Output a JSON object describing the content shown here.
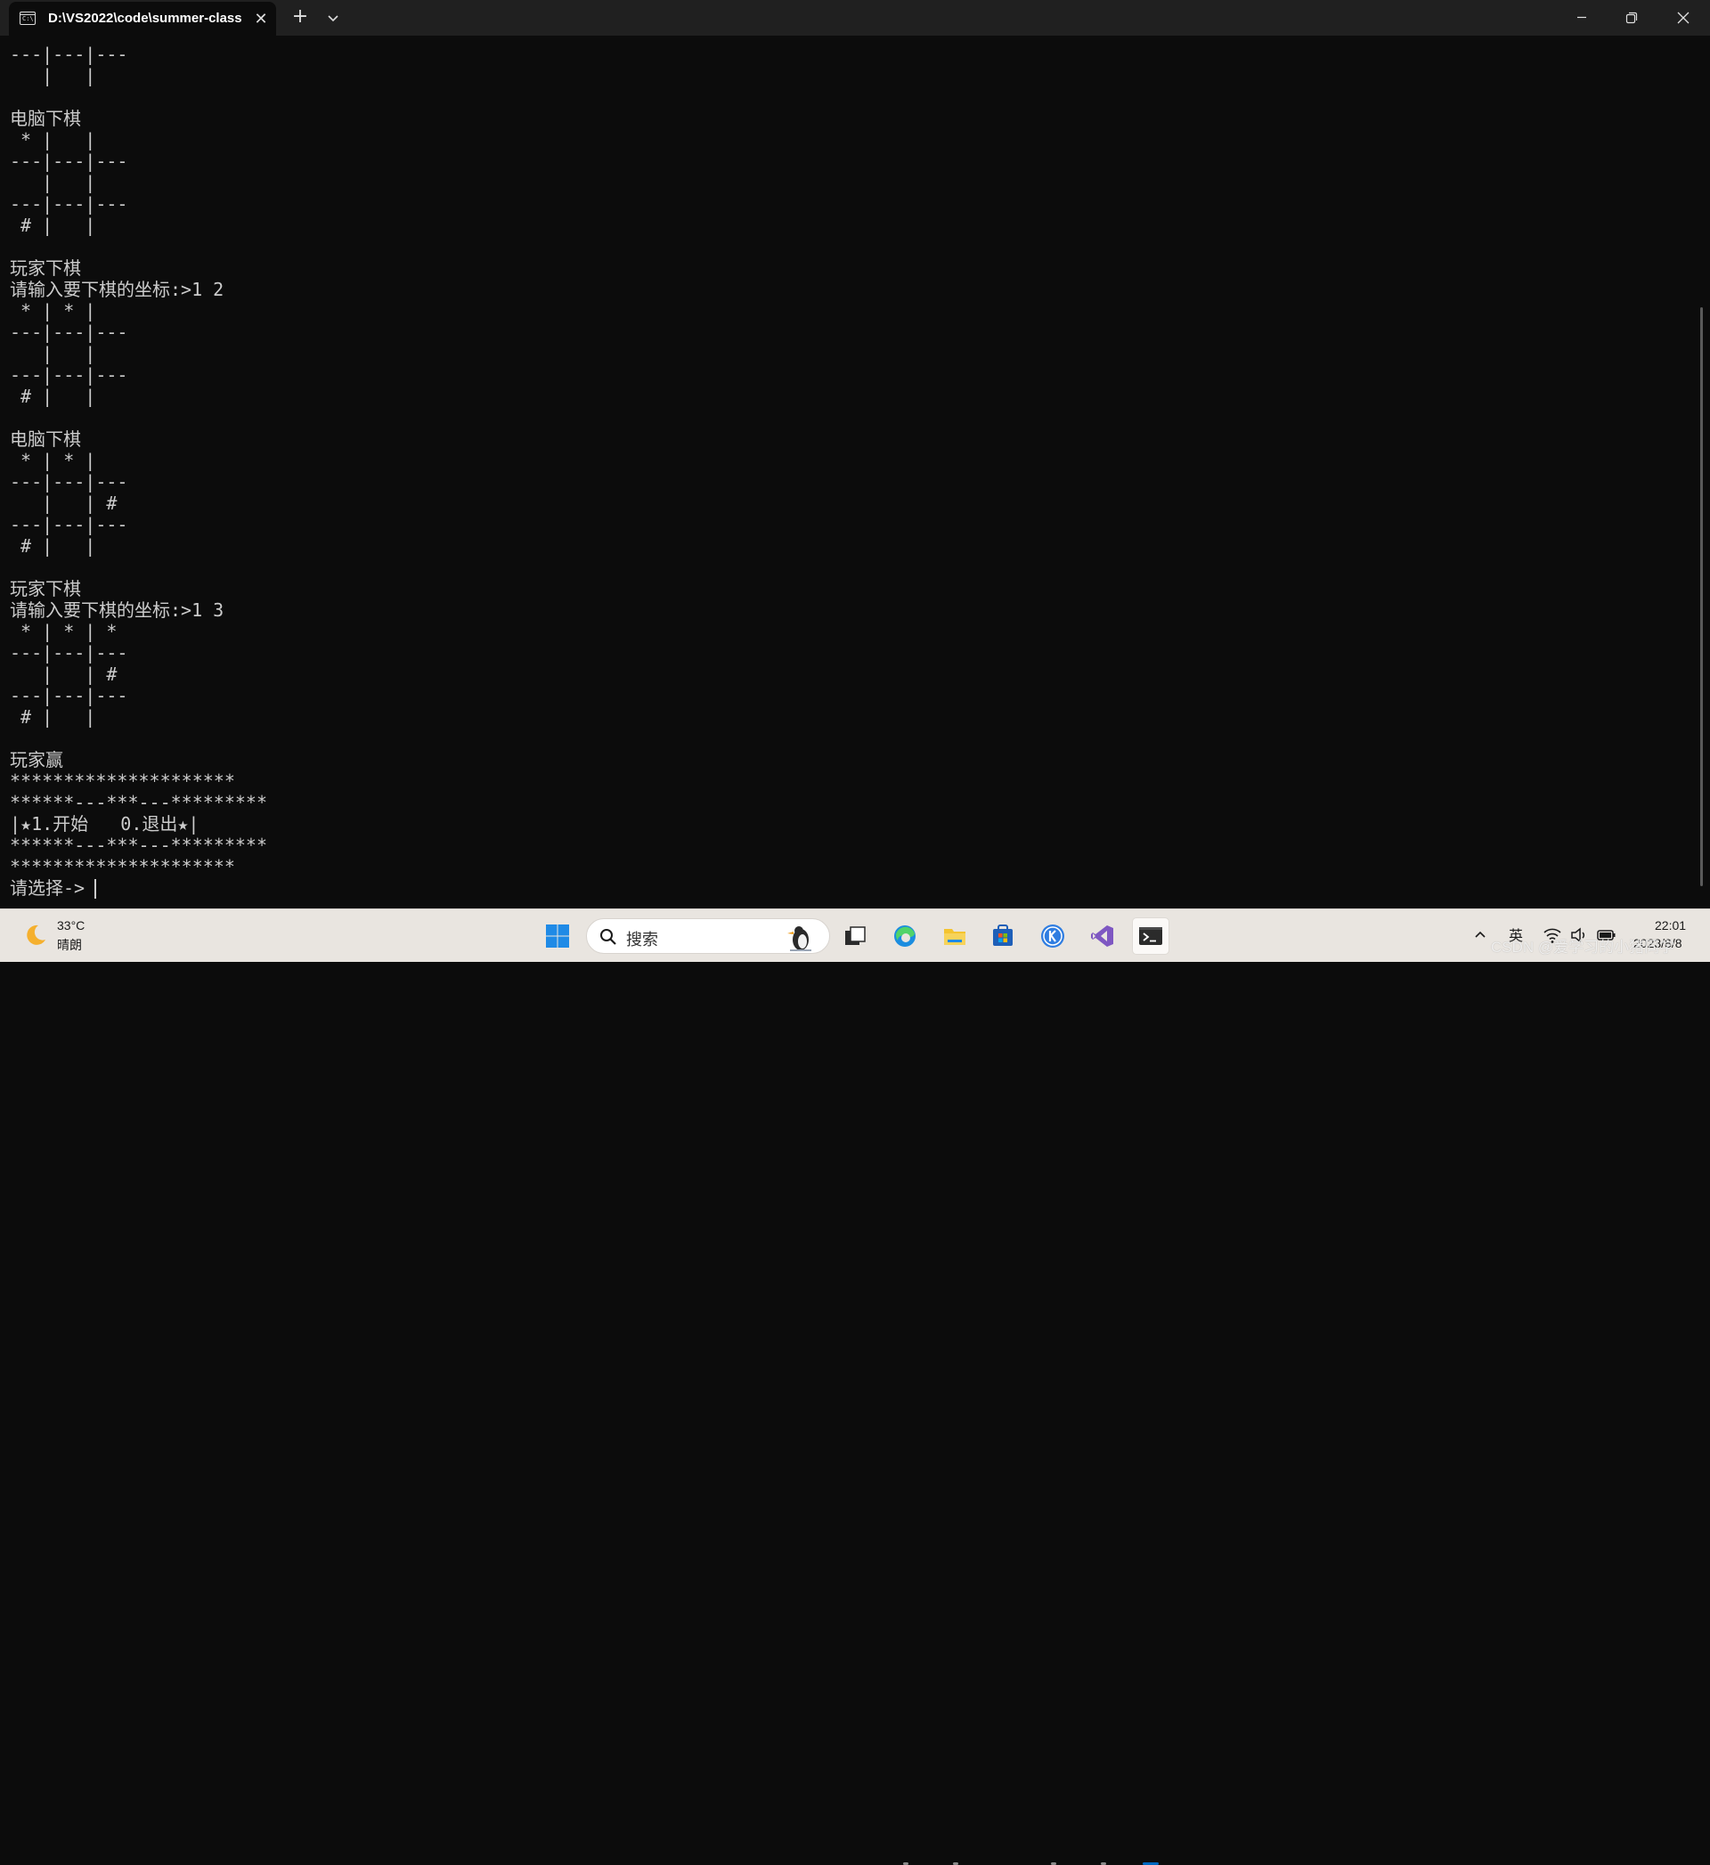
{
  "window": {
    "tab_title": "D:\\VS2022\\code\\summer-class",
    "tab_icon_text": "C:\\",
    "close_tab_glyph": "✕",
    "new_tab_glyph": "+",
    "dropdown_icon": "chevron-down-icon",
    "controls": [
      "minimize-icon",
      "restore-icon",
      "close-icon"
    ]
  },
  "console": {
    "text_color": "#cccccc",
    "background": "#0c0c0c",
    "lines": [
      "---|---|---",
      "   |   |",
      "",
      "电脑下棋",
      " * |   |",
      "---|---|---",
      "   |   |",
      "---|---|---",
      " # |   |",
      "",
      "玩家下棋",
      "请输入要下棋的坐标:>1 2",
      " * | * |",
      "---|---|---",
      "   |   |",
      "---|---|---",
      " # |   |",
      "",
      "电脑下棋",
      " * | * |",
      "---|---|---",
      "   |   | #",
      "---|---|---",
      " # |   |",
      "",
      "玩家下棋",
      "请输入要下棋的坐标:>1 3",
      " * | * | *",
      "---|---|---",
      "   |   | #",
      "---|---|---",
      " # |   |",
      "",
      "玩家赢",
      "*********************",
      "******---***---*********",
      "|★1.开始   0.退出★|",
      "******---***---*********",
      "*********************",
      "请选择->"
    ]
  },
  "taskbar": {
    "weather": {
      "temperature": "33°C",
      "condition": "晴朗",
      "icon": "moon-icon"
    },
    "search": {
      "placeholder": "搜索"
    },
    "apps": [
      {
        "name": "start-button",
        "icon": "windows-logo-icon"
      },
      {
        "name": "task-view",
        "icon": "task-view-icon"
      },
      {
        "name": "edge",
        "icon": "edge-icon"
      },
      {
        "name": "file-explorer",
        "icon": "folder-icon"
      },
      {
        "name": "microsoft-store",
        "icon": "store-icon"
      },
      {
        "name": "k-app",
        "icon": "k-app-icon"
      },
      {
        "name": "visual-studio",
        "icon": "visual-studio-icon"
      },
      {
        "name": "terminal",
        "icon": "terminal-icon",
        "active": true
      }
    ],
    "tray": {
      "ime": "英",
      "time": "22:01",
      "date": "2023/8/8"
    },
    "watermark": "CSDN @爱学习的小猪同学",
    "accent": "#0067c0"
  }
}
